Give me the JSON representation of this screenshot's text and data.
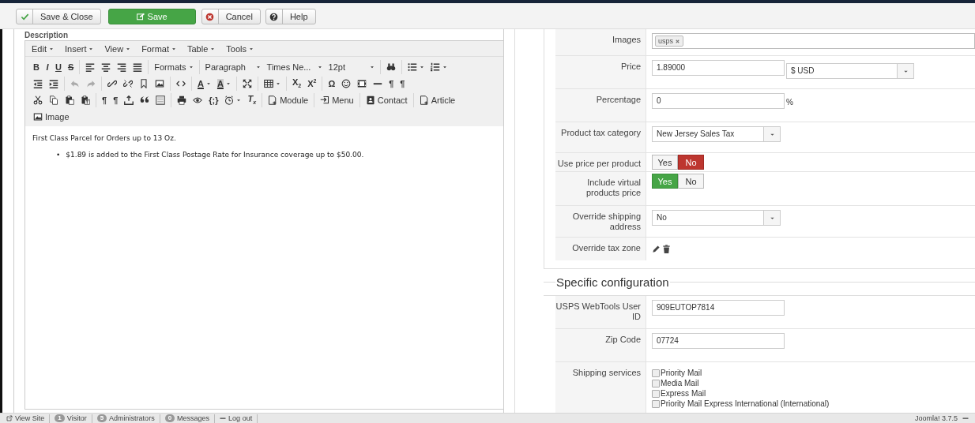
{
  "toolbar": {
    "buttons": [
      {
        "kind": "save-close",
        "label": "Save & Close"
      },
      {
        "kind": "save",
        "label": "Save"
      },
      {
        "kind": "cancel",
        "label": "Cancel"
      },
      {
        "kind": "help",
        "label": "Help"
      }
    ]
  },
  "editor": {
    "label": "Description",
    "menu": [
      "Edit",
      "Insert",
      "View",
      "Format",
      "Table",
      "Tools"
    ],
    "toolbar_rows": [
      [
        {
          "kind": "glyph",
          "text": "B"
        },
        {
          "kind": "glyph",
          "text": "I"
        },
        {
          "kind": "glyph",
          "text": "U"
        },
        {
          "kind": "glyph",
          "text": "S"
        },
        {
          "kind": "sep"
        },
        {
          "kind": "icon"
        },
        {
          "kind": "icon"
        },
        {
          "kind": "icon"
        },
        {
          "kind": "icon"
        },
        {
          "kind": "sep"
        },
        {
          "kind": "menu",
          "label": "Formats"
        },
        {
          "kind": "sep"
        },
        {
          "kind": "select",
          "label": "Paragraph"
        },
        {
          "kind": "select",
          "label": "Times Ne..."
        },
        {
          "kind": "select",
          "label": "12pt"
        },
        {
          "kind": "sep"
        },
        {
          "kind": "icon"
        },
        {
          "kind": "sep"
        },
        {
          "kind": "split"
        },
        {
          "kind": "split"
        }
      ],
      [
        {
          "kind": "icon"
        },
        {
          "kind": "icon"
        },
        {
          "kind": "sep"
        },
        {
          "kind": "icon"
        },
        {
          "kind": "icon"
        },
        {
          "kind": "sep"
        },
        {
          "kind": "icon"
        },
        {
          "kind": "icon"
        },
        {
          "kind": "icon"
        },
        {
          "kind": "icon"
        },
        {
          "kind": "sep"
        },
        {
          "kind": "icon"
        },
        {
          "kind": "sep"
        },
        {
          "kind": "glyph-split",
          "text": "A"
        },
        {
          "kind": "glyph-split",
          "text": "A"
        },
        {
          "kind": "sep"
        },
        {
          "kind": "icon"
        },
        {
          "kind": "sep"
        },
        {
          "kind": "split"
        },
        {
          "kind": "sep"
        },
        {
          "kind": "glyph",
          "text": "X$_{2}$"
        },
        {
          "kind": "glyph",
          "text": "X$^{2}$"
        },
        {
          "kind": "sep"
        },
        {
          "kind": "glyph",
          "text": "Ω"
        },
        {
          "kind": "icon"
        },
        {
          "kind": "icon"
        },
        {
          "kind": "icon"
        },
        {
          "kind": "glyph",
          "text": "¶"
        },
        {
          "kind": "glyph",
          "text": "¶"
        }
      ],
      [
        {
          "kind": "icon"
        },
        {
          "kind": "icon"
        },
        {
          "kind": "icon"
        },
        {
          "kind": "icon"
        },
        {
          "kind": "sep"
        },
        {
          "kind": "glyph",
          "text": "¶"
        },
        {
          "kind": "glyph",
          "text": "¶"
        },
        {
          "kind": "icon"
        },
        {
          "kind": "icon"
        },
        {
          "kind": "icon"
        },
        {
          "kind": "sep"
        },
        {
          "kind": "icon"
        },
        {
          "kind": "icon"
        },
        {
          "kind": "glyph",
          "text": "{;}"
        },
        {
          "kind": "split"
        },
        {
          "kind": "glyph",
          "text": "T$_{x}$"
        },
        {
          "kind": "sep"
        },
        {
          "kind": "labeled",
          "label": "Module"
        },
        {
          "kind": "sep"
        },
        {
          "kind": "labeled",
          "label": "Menu"
        },
        {
          "kind": "sep"
        },
        {
          "kind": "labeled",
          "label": "Contact"
        },
        {
          "kind": "sep"
        },
        {
          "kind": "labeled",
          "label": "Article"
        }
      ],
      [
        {
          "kind": "labeled",
          "label": "Image"
        }
      ]
    ],
    "content": {
      "paragraph": "First Class Parcel for Orders up to 13 Oz.",
      "bullets": [
        {
          "marker": "•",
          "text": "$1.89 is added to the First Class Postage Rate for Insurance coverage up to $50.00."
        }
      ]
    }
  },
  "product_form": {
    "rows": [
      {
        "label": "Images",
        "kind": "tags",
        "tags": [
          "usps"
        ]
      },
      {
        "label": "Price",
        "kind": "price",
        "value": "1.89000",
        "currency": "$ USD"
      },
      {
        "label": "Percentage",
        "kind": "text",
        "value": "0",
        "suffix": "%"
      },
      {
        "label": "Product tax category",
        "kind": "select",
        "value": "New Jersey Sales Tax"
      },
      {
        "label": "Use price per product",
        "kind": "toggle",
        "options": [
          {
            "label": "Yes",
            "selected": false
          },
          {
            "label": "No",
            "selected": true
          }
        ]
      },
      {
        "label": "Include virtual products price",
        "kind": "toggle",
        "options": [
          {
            "label": "Yes",
            "selected": true
          },
          {
            "label": "No",
            "selected": false
          }
        ]
      },
      {
        "label": "Override shipping address",
        "kind": "select",
        "value": "No"
      },
      {
        "label": "Override tax zone",
        "kind": "actions"
      }
    ]
  },
  "specific_configuration": {
    "title": "Specific configuration",
    "rows": [
      {
        "label": "USPS WebTools User ID",
        "kind": "text",
        "value": "909EUTOP7814"
      },
      {
        "label": "Zip Code",
        "kind": "text",
        "value": "07724"
      },
      {
        "label": "Shipping services",
        "kind": "checkboxes",
        "options": [
          {
            "label": "Priority Mail",
            "checked": false
          },
          {
            "label": "Media Mail",
            "checked": false
          },
          {
            "label": "Express Mail",
            "checked": false
          },
          {
            "label": "Priority Mail Express International (International)",
            "checked": false
          }
        ]
      }
    ]
  },
  "status_bar": {
    "items": [
      {
        "kind": "link",
        "label": "View Site"
      },
      {
        "kind": "count",
        "count": "1",
        "label": "Visitor"
      },
      {
        "kind": "count",
        "count": "5",
        "label": "Administrators"
      },
      {
        "kind": "count",
        "count": "0",
        "label": "Messages"
      },
      {
        "kind": "logout",
        "label": "Log out"
      }
    ],
    "version": "Joomla! 3.7.5"
  }
}
